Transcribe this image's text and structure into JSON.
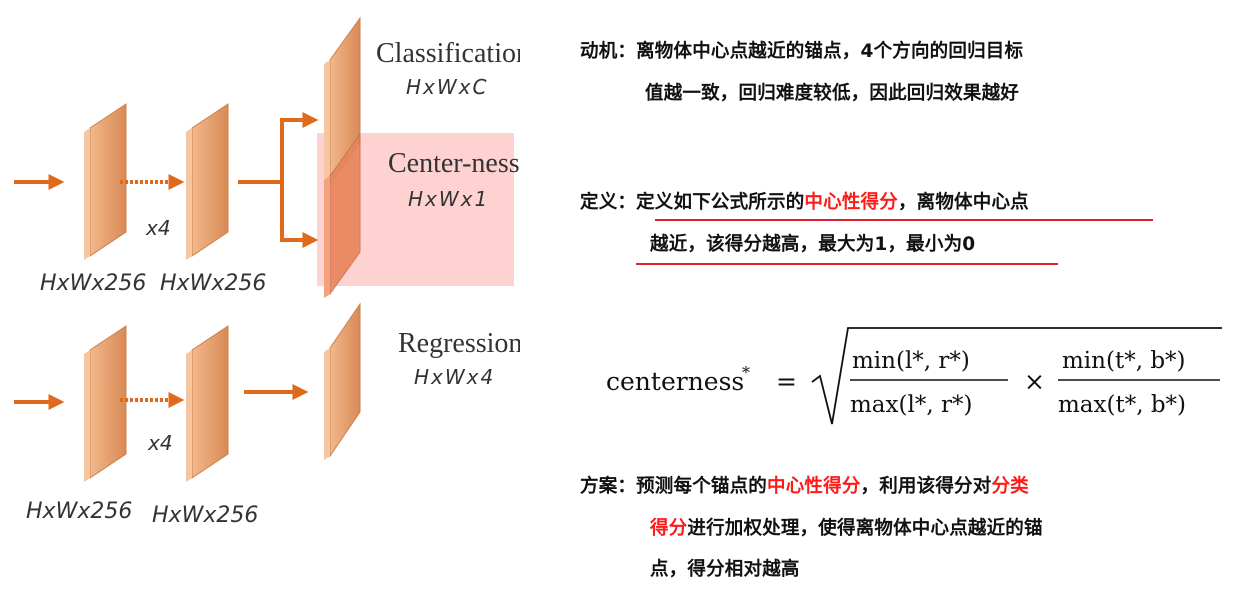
{
  "diagram": {
    "heads": {
      "classification": {
        "label": "Classification",
        "dims": "HxWxC"
      },
      "centerness": {
        "label": "Center-ness",
        "dims": "HxWx1"
      },
      "regression": {
        "label": "Regression",
        "dims": "HxWx4"
      }
    },
    "repeat_top": "x4",
    "repeat_bottom": "x4",
    "dims_top_left": "HxWx256",
    "dims_top_right": "HxWx256",
    "dims_bottom_left": "HxWx256",
    "dims_bottom_right": "HxWx256",
    "colors": {
      "block": "#e8a06e",
      "arrow": "#e06a1c",
      "highlight": "#ffd0d0"
    }
  },
  "text": {
    "motivation": {
      "prefix": "动机：",
      "line1": "离物体中心点越近的锚点，4个方向的回归目标",
      "line2": "值越一致，回归难度较低，因此回归效果越好"
    },
    "definition": {
      "prefix": "定义：",
      "line1_a": "定义如下公式所示的",
      "line1_red": "中心性得分",
      "line1_b": "，离物体中心点",
      "line2": "越近，该得分越高，最大为1，最小为0"
    },
    "formula": {
      "lhs": "centerness",
      "sup": "*",
      "eq": "=",
      "frac1_num": "min(l*, r*)",
      "frac1_den": "max(l*, r*)",
      "times": "×",
      "frac2_num": "min(t*, b*)",
      "frac2_den": "max(t*, b*)"
    },
    "scheme": {
      "prefix": "方案：",
      "line1_a": "预测每个锚点的",
      "line1_red": "中心性得分",
      "line1_b": "，利用该得分对",
      "line1_red2": "分类",
      "line2_red": "得分",
      "line2_b": "进行加权处理，使得离物体中心点越近的锚",
      "line3": "点，得分相对越高"
    },
    "colors": {
      "highlight_text": "#ff1a1a",
      "underline": "#e0202a"
    }
  }
}
